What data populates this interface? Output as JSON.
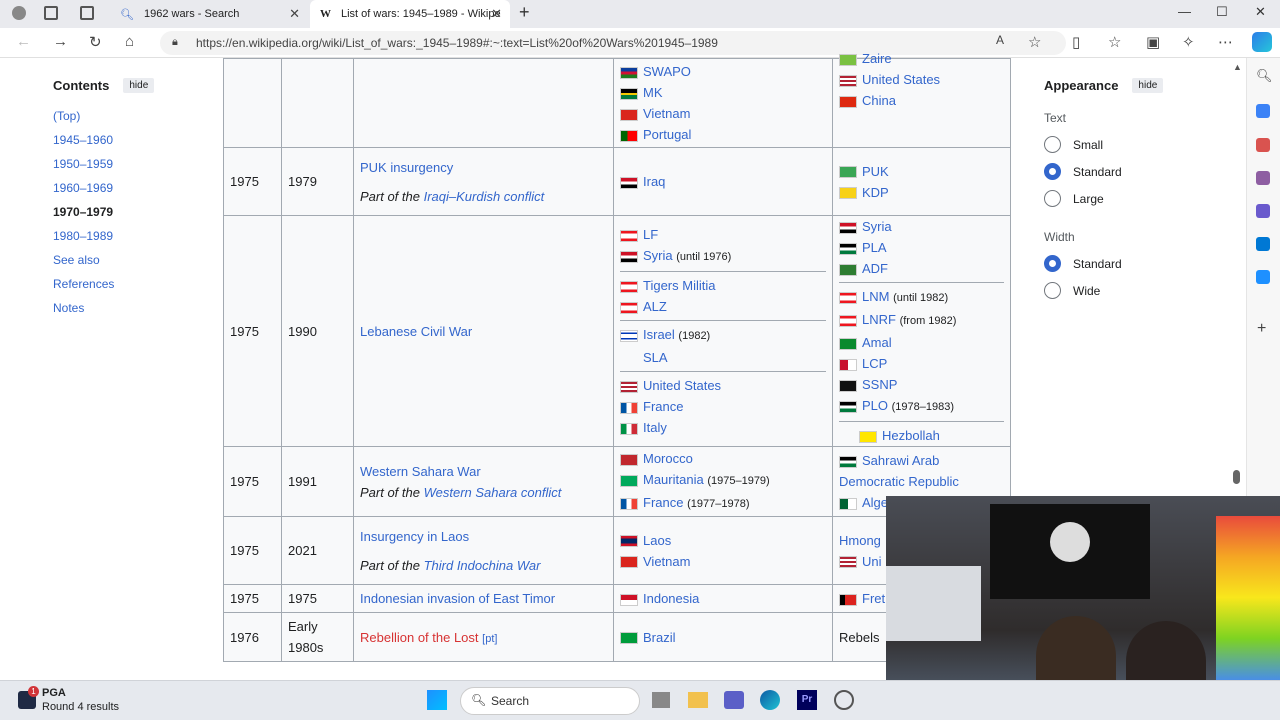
{
  "browser": {
    "tabs": [
      {
        "label": "1962 wars - Search",
        "icon": "search-icon"
      },
      {
        "label": "List of wars: 1945–1989 - Wikipe",
        "icon": "wikipedia-icon"
      }
    ],
    "url": "https://en.wikipedia.org/wiki/List_of_wars:_1945–1989#:~:text=List%20of%20Wars%201945–1989"
  },
  "toc": {
    "title": "Contents",
    "hide": "hide",
    "items": [
      "(Top)",
      "1945–1960",
      "1950–1959",
      "1960–1969",
      "1970–1979",
      "1980–1989",
      "See also",
      "References",
      "Notes"
    ]
  },
  "appearance": {
    "title": "Appearance",
    "hide": "hide",
    "text_label": "Text",
    "text_options": [
      "Small",
      "Standard",
      "Large"
    ],
    "text_selected": "Standard",
    "width_label": "Width",
    "width_options": [
      "Standard",
      "Wide"
    ],
    "width_selected": "Standard"
  },
  "rows": [
    {
      "start": "",
      "end": "",
      "war": "",
      "part": "",
      "partlink": "",
      "side1": [
        "SWAPO",
        "MK",
        "Vietnam",
        "Portugal"
      ],
      "side2": [
        "Zaire",
        "United States",
        "China"
      ]
    },
    {
      "start": "1975",
      "end": "1979",
      "war": "PUK insurgency",
      "part": "Part of the ",
      "partlink": "Iraqi–Kurdish conflict",
      "side1": [
        "Iraq"
      ],
      "side2": [
        "PUK",
        "KDP"
      ]
    },
    {
      "start": "1975",
      "end": "1990",
      "war": "Lebanese Civil War",
      "part": "",
      "partlink": "",
      "side1": [
        "LF",
        "Syria",
        "Tigers Militia",
        "ALZ",
        "Israel",
        "SLA",
        "United States",
        "France",
        "Italy"
      ],
      "side1_notes": {
        "Syria": "(until 1976)",
        "Israel": "(1982)"
      },
      "side2": [
        "Syria",
        "PLA",
        "ADF",
        "LNM",
        "LNRF",
        "Amal",
        "LCP",
        "SSNP",
        "PLO",
        "Hezbollah"
      ],
      "side2_notes": {
        "LNM": "(until 1982)",
        "LNRF": "(from 1982)",
        "PLO": "(1978–1983)"
      }
    },
    {
      "start": "1975",
      "end": "1991",
      "war": "Western Sahara War",
      "part": "Part of the ",
      "partlink": "Western Sahara conflict",
      "side1": [
        "Morocco",
        "Mauritania",
        "France"
      ],
      "side1_notes": {
        "Mauritania": "(1975–1979)",
        "France": "(1977–1978)"
      },
      "side2": [
        "Sahrawi Arab Democratic Republic",
        "Alge"
      ]
    },
    {
      "start": "1975",
      "end": "2021",
      "war": "Insurgency in Laos",
      "part": "Part of the ",
      "partlink": "Third Indochina War",
      "side1": [
        "Laos",
        "Vietnam"
      ],
      "side2": [
        "Hmong",
        "Uni"
      ]
    },
    {
      "start": "1975",
      "end": "1975",
      "war": "Indonesian invasion of East Timor",
      "part": "",
      "partlink": "",
      "side1": [
        "Indonesia"
      ],
      "side2": [
        "Fret"
      ]
    },
    {
      "start": "1976",
      "end": "Early 1980s",
      "war": "Rebellion of the Lost",
      "war_suffix": "[pt]",
      "part": "",
      "partlink": "",
      "side1": [
        "Brazil"
      ],
      "side2": [
        "Rebels"
      ]
    }
  ],
  "taskbar": {
    "news_title": "PGA",
    "news_sub": "Round 4 results",
    "badge": "1",
    "search": "Search"
  },
  "colors": {
    "link": "#3366cc",
    "redlink": "#d73333",
    "accent": "#3366cc"
  }
}
